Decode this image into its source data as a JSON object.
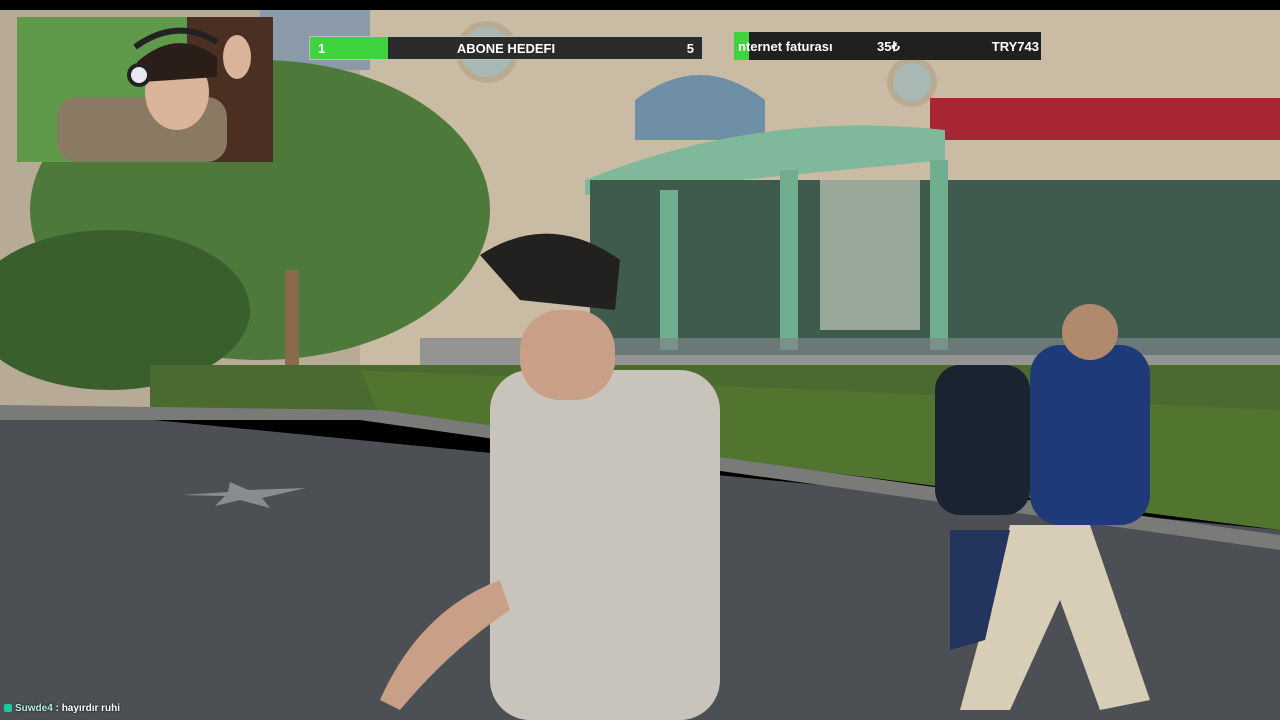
{
  "goal": {
    "current": "1",
    "title": "ABONE HEDEFI",
    "target": "5",
    "progress": 0.2
  },
  "donation": {
    "label": "nternet faturası",
    "amount": "35₺",
    "target": "TRY743",
    "progress": 0.05
  },
  "chat": {
    "username": "Suwde4",
    "separator": ":",
    "message": "hayırdır ruhi"
  },
  "colors": {
    "progress_fill": "#3fd33f",
    "bar_bg": "#2b2b2b"
  }
}
